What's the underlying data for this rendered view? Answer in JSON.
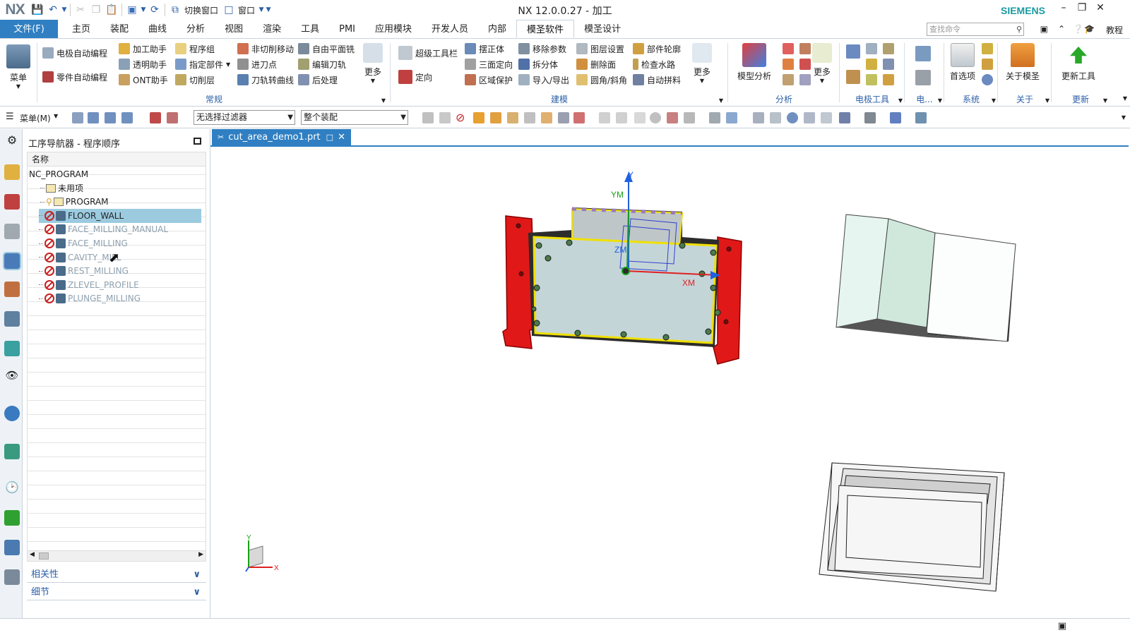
{
  "titlebar": {
    "logo": "NX",
    "switch_window": "切换窗口",
    "window_menu": "窗口",
    "title": "NX 12.0.0.27 - 加工",
    "brand": "SIEMENS"
  },
  "menubar": {
    "file": "文件(F)",
    "tabs": [
      "主页",
      "装配",
      "曲线",
      "分析",
      "视图",
      "渲染",
      "工具",
      "PMI",
      "应用模块",
      "开发人员",
      "内部",
      "模圣软件",
      "模圣设计"
    ],
    "active_tab": "模圣软件",
    "search_placeholder": "查找命令",
    "tutorial": "教程"
  },
  "ribbon": {
    "menu_button": "菜单",
    "group_common": {
      "label": "常规",
      "items": [
        "电极自动编程",
        "零件自动编程",
        "加工助手",
        "透明助手",
        "ONT助手",
        "程序组",
        "指定部件",
        "切削层",
        "非切削移动",
        "进刀点",
        "刀轨转曲线",
        "自由平面铣",
        "编辑刀轨",
        "后处理"
      ],
      "more": "更多"
    },
    "group_modeling": {
      "label": "建模",
      "items": [
        "超级工具栏",
        "定向",
        "摆正体",
        "三面定向",
        "区域保护",
        "移除参数",
        "拆分体",
        "导入/导出",
        "图层设置",
        "删除面",
        "圆角/斜角",
        "部件轮廓",
        "检查水路",
        "自动拼料"
      ],
      "more": "更多"
    },
    "group_analysis": {
      "label": "分析",
      "model_analysis": "模型分析",
      "more": "更多"
    },
    "group_electrode": {
      "label": "电极工具"
    },
    "group_elec_short": {
      "label": "电..."
    },
    "group_system": {
      "label": "系统",
      "preferences": "首选项"
    },
    "group_about": {
      "label": "关于",
      "about_button": "关于模圣"
    },
    "group_update": {
      "label": "更新",
      "update_button": "更新工具"
    }
  },
  "toolbar2": {
    "menu": "菜单(M)",
    "filter": "无选择过滤器",
    "assembly": "整个装配"
  },
  "navigator": {
    "title": "工序导航器 - 程序顺序",
    "column": "名称",
    "rows": [
      {
        "label": "NC_PROGRAM",
        "indent": 0,
        "state": "normal",
        "icon": "none"
      },
      {
        "label": "未用项",
        "indent": 1,
        "state": "normal",
        "icon": "folder"
      },
      {
        "label": "PROGRAM",
        "indent": 1,
        "state": "normal",
        "icon": "folder"
      },
      {
        "label": "FLOOR_WALL",
        "indent": 2,
        "state": "selected",
        "icon": "op"
      },
      {
        "label": "FACE_MILLING_MANUAL",
        "indent": 2,
        "state": "dim",
        "icon": "op"
      },
      {
        "label": "FACE_MILLING",
        "indent": 2,
        "state": "dim",
        "icon": "op"
      },
      {
        "label": "CAVITY_MILL",
        "indent": 2,
        "state": "dim",
        "icon": "op"
      },
      {
        "label": "REST_MILLING",
        "indent": 2,
        "state": "dim",
        "icon": "op"
      },
      {
        "label": "ZLEVEL_PROFILE",
        "indent": 2,
        "state": "dim",
        "icon": "op"
      },
      {
        "label": "PLUNGE_MILLING",
        "indent": 2,
        "state": "dim",
        "icon": "op"
      }
    ],
    "panel_dependencies": "相关性",
    "panel_details": "细节"
  },
  "graphics": {
    "file_tab": "cut_area_demo1.prt",
    "axis_y": "Y",
    "axis_ym": "YM",
    "axis_zm": "ZM",
    "axis_xm": "XM",
    "triad_x": "X",
    "triad_y": "Y"
  },
  "colors": {
    "accent": "#2f7fc2",
    "brand": "#1a9aa0",
    "part_red": "#e01818",
    "part_surface": "#c4d5d8",
    "outline_yellow": "#f0e000"
  }
}
